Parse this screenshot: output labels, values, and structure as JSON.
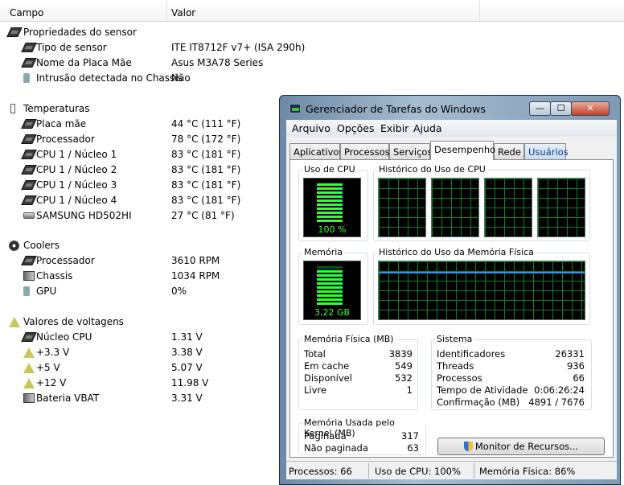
{
  "sensor_panel": {
    "col_field": "Campo",
    "col_value": "Valor",
    "groups": [
      {
        "title": "Propriedades do sensor",
        "icon": "chip-icon",
        "items": [
          {
            "label": "Tipo de sensor",
            "value": "ITE IT8712F v7+  (ISA 290h)",
            "icon": "chip-icon"
          },
          {
            "label": "Nome da Placa Mãe",
            "value": "Asus M3A78 Series",
            "icon": "chip-icon"
          },
          {
            "label": "Intrusão detectada no Chassis",
            "value": "Não",
            "icon": "lock-icon"
          }
        ]
      },
      {
        "title": "Temperaturas",
        "icon": "thermometer-icon",
        "items": [
          {
            "label": "Placa mãe",
            "value": "44 °C  (111 °F)",
            "icon": "chip-icon"
          },
          {
            "label": "Processador",
            "value": "78 °C  (172 °F)",
            "icon": "cpu-icon"
          },
          {
            "label": "CPU 1 / Núcleo 1",
            "value": "83 °C  (181 °F)",
            "icon": "cpu-icon"
          },
          {
            "label": "CPU 1 / Núcleo 2",
            "value": "83 °C  (181 °F)",
            "icon": "cpu-icon"
          },
          {
            "label": "CPU 1 / Núcleo 3",
            "value": "83 °C  (181 °F)",
            "icon": "cpu-icon"
          },
          {
            "label": "CPU 1 / Núcleo 4",
            "value": "83 °C  (181 °F)",
            "icon": "cpu-icon"
          },
          {
            "label": "SAMSUNG HD502HI",
            "value": "27 °C  (81 °F)",
            "icon": "hard-drive-icon"
          }
        ]
      },
      {
        "title": "Coolers",
        "icon": "fan-icon",
        "items": [
          {
            "label": "Processador",
            "value": "3610 RPM",
            "icon": "cpu-icon"
          },
          {
            "label": "Chassis",
            "value": "1034 RPM",
            "icon": "chassis-icon"
          },
          {
            "label": "GPU",
            "value": "0%",
            "icon": "gpu-icon"
          }
        ]
      },
      {
        "title": "Valores de voltagens",
        "icon": "voltage-icon",
        "items": [
          {
            "label": "Núcleo CPU",
            "value": "1.31 V",
            "icon": "cpu-icon"
          },
          {
            "label": "+3.3 V",
            "value": "3.38 V",
            "icon": "voltage-icon"
          },
          {
            "label": "+5 V",
            "value": "5.07 V",
            "icon": "voltage-icon"
          },
          {
            "label": "+12 V",
            "value": "11.98 V",
            "icon": "voltage-icon"
          },
          {
            "label": "Bateria VBAT",
            "value": "3.31 V",
            "icon": "battery-icon"
          }
        ]
      }
    ]
  },
  "task_manager": {
    "title": "Gerenciador de Tarefas do Windows",
    "window_buttons": {
      "minimize": "—",
      "maximize": "☐",
      "close": "✕"
    },
    "menu": [
      "Arquivo",
      "Opções",
      "Exibir",
      "Ajuda"
    ],
    "tabs": [
      "Aplicativos",
      "Processos",
      "Serviços",
      "Desempenho",
      "Rede",
      "Usuários"
    ],
    "active_tab": "Desempenho",
    "cpu_usage": {
      "title": "Uso de CPU",
      "value": "100 %",
      "percent": 100
    },
    "cpu_history_title": "Histórico do Uso de CPU",
    "memory": {
      "title": "Memória",
      "value": "3,22 GB",
      "percent": 86
    },
    "memory_history_title": "Histórico do Uso da Memória Física",
    "physical_memory": {
      "title": "Memória Física (MB)",
      "rows": [
        {
          "k": "Total",
          "v": "3839"
        },
        {
          "k": "Em cache",
          "v": "549"
        },
        {
          "k": "Disponível",
          "v": "532"
        },
        {
          "k": "Livre",
          "v": "1"
        }
      ]
    },
    "system": {
      "title": "Sistema",
      "rows": [
        {
          "k": "Identificadores",
          "v": "26331"
        },
        {
          "k": "Threads",
          "v": "936"
        },
        {
          "k": "Processos",
          "v": "66"
        },
        {
          "k": "Tempo de Atividade",
          "v": "0:06:26:24"
        },
        {
          "k": "Confirmação (MB)",
          "v": "4891 / 7676"
        }
      ]
    },
    "kernel_memory": {
      "title": "Memória Usada pelo Kernel (MB)",
      "rows": [
        {
          "k": "Paginada",
          "v": "317"
        },
        {
          "k": "Não paginada",
          "v": "63"
        }
      ]
    },
    "resource_monitor_button": "Monitor de Recursos...",
    "status": {
      "processes": "Processos: 66",
      "cpu": "Uso de CPU: 100%",
      "memory": "Memória Física: 86%"
    },
    "colors": {
      "graph_green": "#33ff33",
      "grid_green": "#0a7f2a",
      "mem_line": "#3a8fe8"
    }
  }
}
